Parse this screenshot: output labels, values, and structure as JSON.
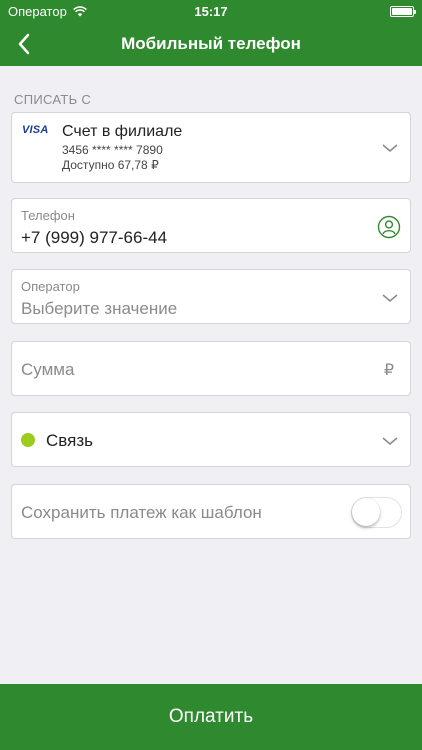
{
  "status": {
    "carrier": "Оператор",
    "time": "15:17"
  },
  "nav": {
    "title": "Мобильный телефон"
  },
  "source": {
    "section_label": "СПИСАТЬ С",
    "card_brand": "VISA",
    "name": "Счет в филиале",
    "number": "3456 **** **** 7890",
    "available": "Доступно 67,78 ₽"
  },
  "phone": {
    "label": "Телефон",
    "value": "+7 (999) 977-66-44"
  },
  "operator": {
    "label": "Оператор",
    "placeholder": "Выберите значение"
  },
  "sum": {
    "placeholder": "Сумма",
    "currency": "₽"
  },
  "category": {
    "label": "Связь",
    "color": "#9ccc1d"
  },
  "save_template": {
    "label": "Сохранить платеж как шаблон",
    "enabled": false
  },
  "pay_button": {
    "label": "Оплатить"
  },
  "colors": {
    "brand_green": "#2f8a2f",
    "background": "#efeff4"
  },
  "icons": {
    "back": "chevron-left-icon",
    "contact": "contact-icon",
    "expand": "chevron-down-icon",
    "wifi": "wifi-icon",
    "battery": "battery-icon"
  }
}
